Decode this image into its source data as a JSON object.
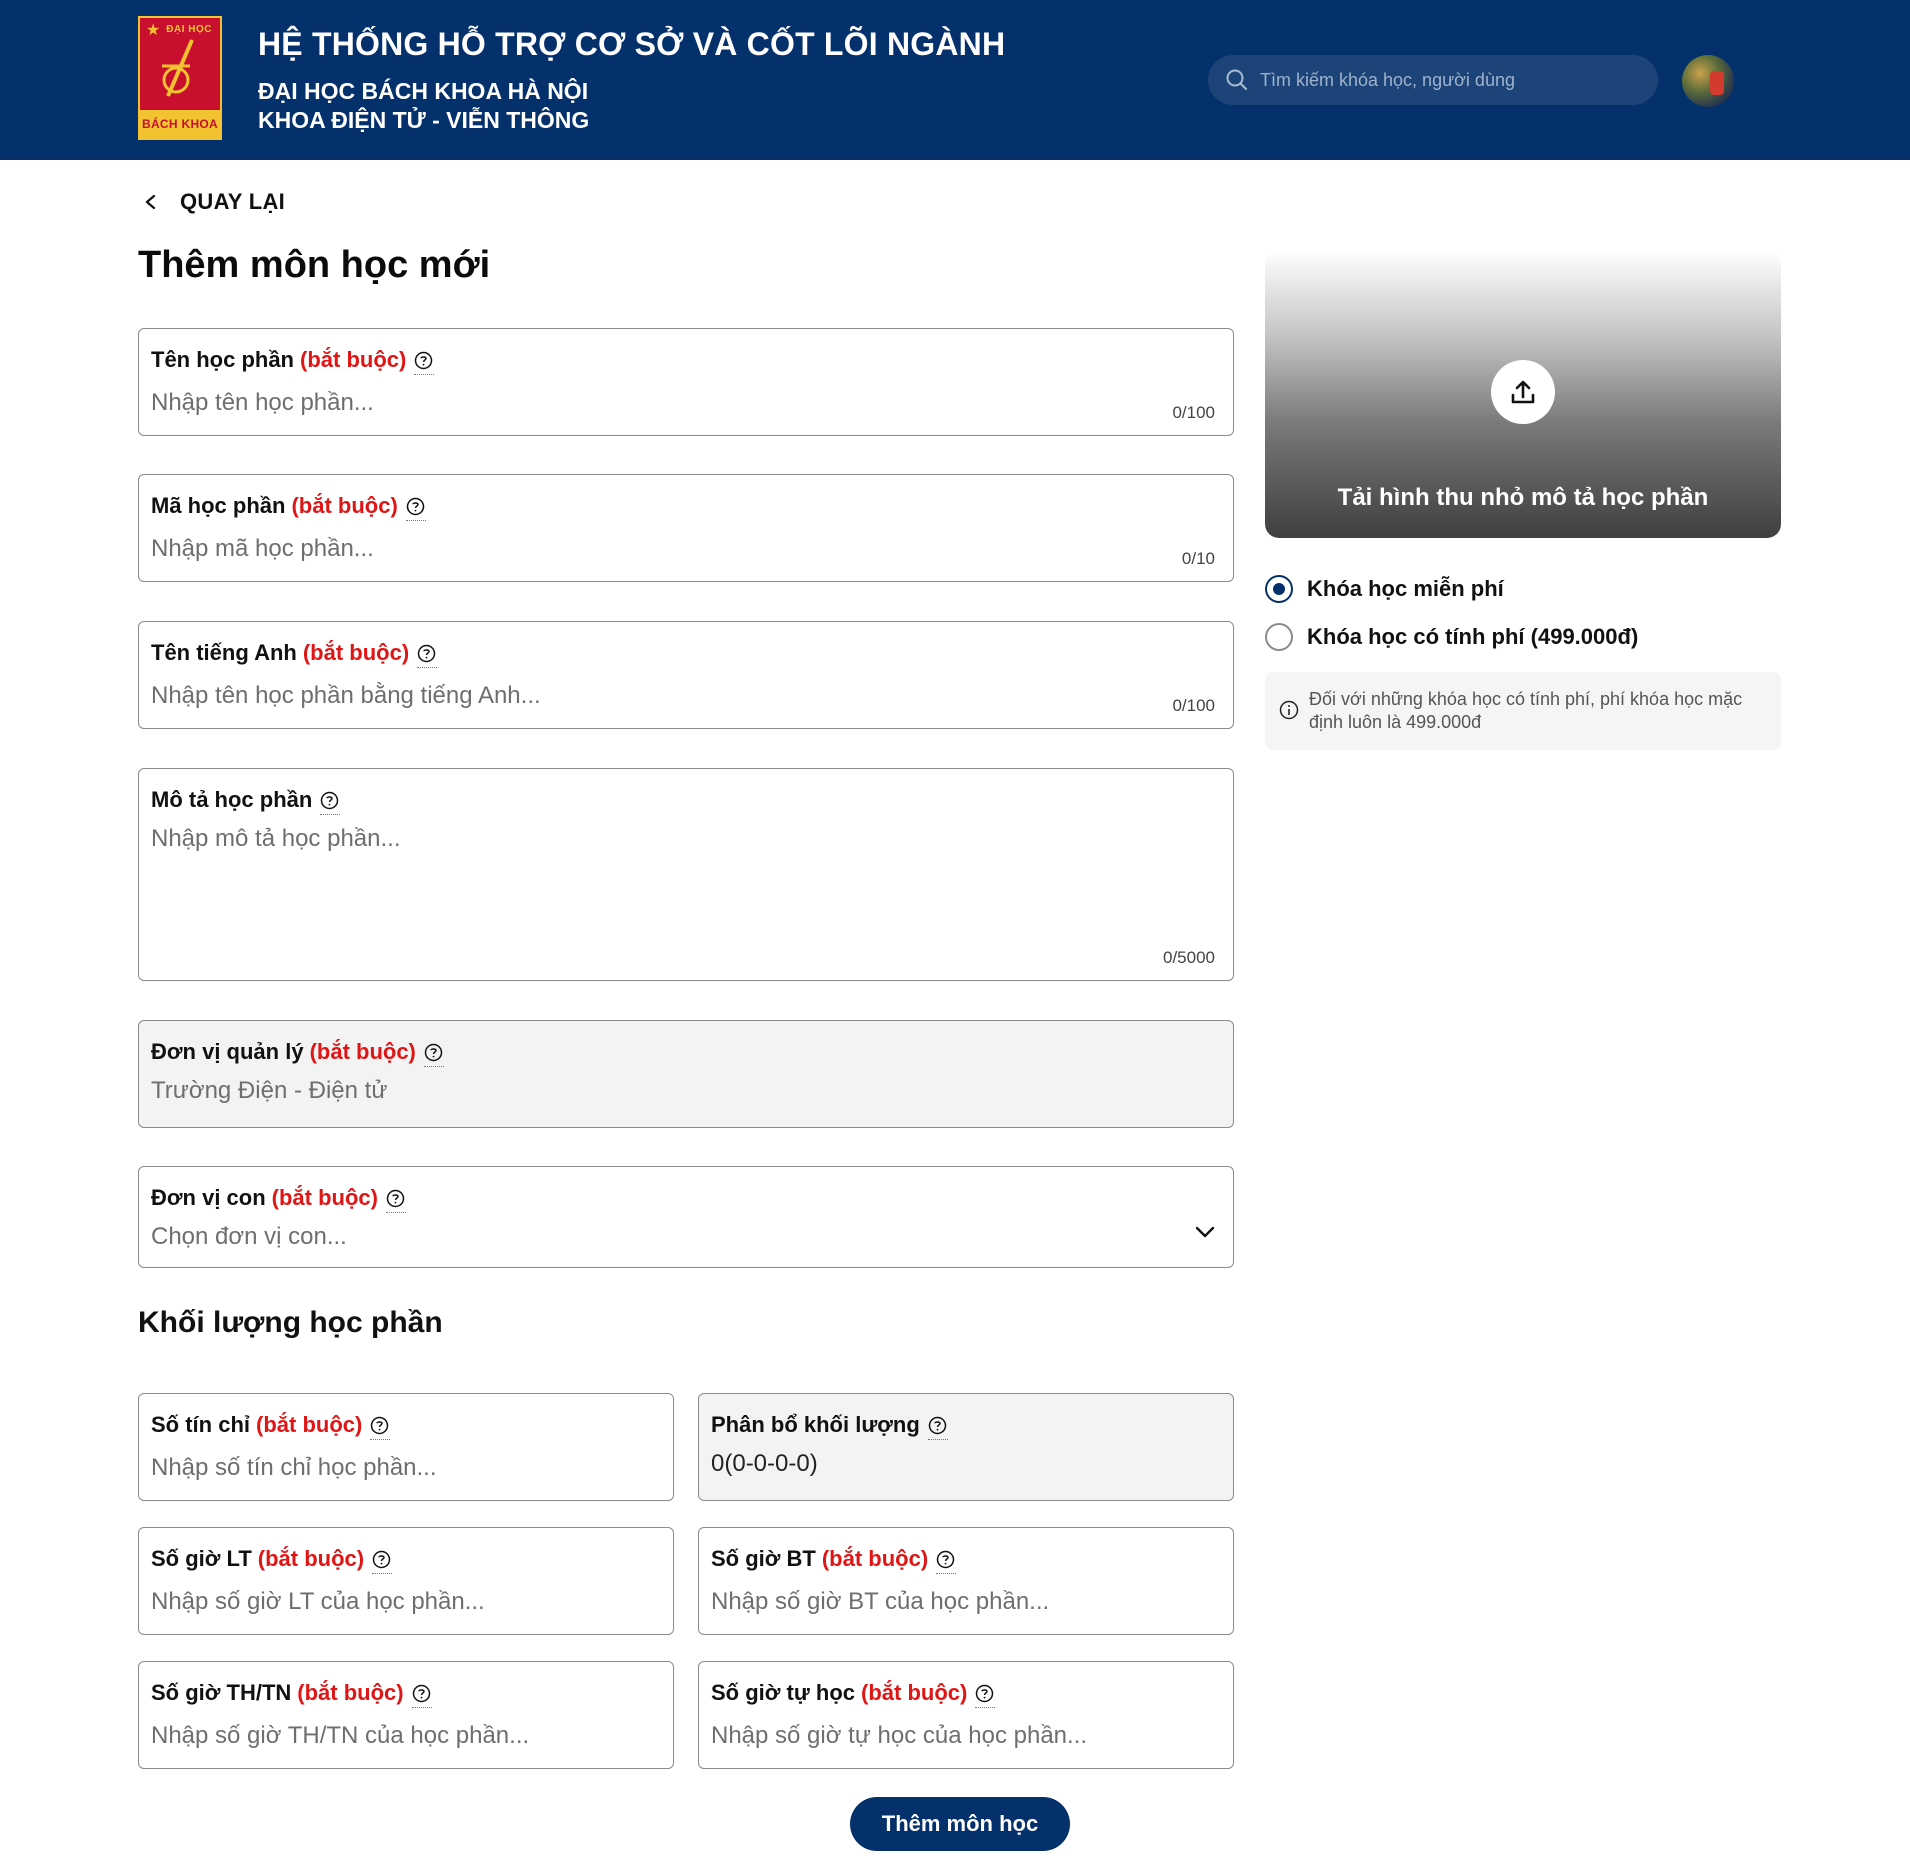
{
  "header": {
    "logo_top": "ĐẠI HỌC",
    "logo_bottom": "BÁCH KHOA",
    "title": "HỆ THỐNG HỖ TRỢ CƠ SỞ VÀ CỐT LÕI NGÀNH",
    "subtitle1": "ĐẠI HỌC BÁCH KHOA HÀ NỘI",
    "subtitle2": "KHOA ĐIỆN TỬ - VIỄN THÔNG",
    "search_placeholder": "Tìm kiếm khóa học, người dùng"
  },
  "back_label": "QUAY LẠI",
  "page_title": "Thêm môn học mới",
  "required_tag": "(bắt buộc)",
  "fields": {
    "ten_hoc_phan": {
      "label": "Tên học phần",
      "placeholder": "Nhập tên học phần...",
      "counter": "0/100"
    },
    "ma_hoc_phan": {
      "label": "Mã học phần",
      "placeholder": "Nhập mã học phần...",
      "counter": "0/10"
    },
    "ten_tieng_anh": {
      "label": "Tên tiếng Anh",
      "placeholder": "Nhập tên học phần bằng tiếng Anh...",
      "counter": "0/100"
    },
    "mo_ta": {
      "label": "Mô tả học phần",
      "placeholder": "Nhập mô tả học phần...",
      "counter": "0/5000"
    },
    "don_vi_quan_ly": {
      "label": "Đơn vị quản lý",
      "value": "Trường Điện - Điện tử"
    },
    "don_vi_con": {
      "label": "Đơn vị con",
      "placeholder": "Chọn đơn vị con..."
    }
  },
  "section_title": "Khối lượng học phần",
  "workload": {
    "so_tin_chi": {
      "label": "Số tín chỉ",
      "placeholder": "Nhập số tín chỉ học phần..."
    },
    "phan_bo": {
      "label": "Phân bổ khối lượng",
      "value": "0(0-0-0-0)"
    },
    "so_gio_lt": {
      "label": "Số giờ LT",
      "placeholder": "Nhập số giờ LT của học phần..."
    },
    "so_gio_bt": {
      "label": "Số giờ BT",
      "placeholder": "Nhập số giờ BT của học phần..."
    },
    "so_gio_th": {
      "label": "Số giờ TH/TN",
      "placeholder": "Nhập số giờ TH/TN của học phần..."
    },
    "so_gio_tu_hoc": {
      "label": "Số giờ tự học",
      "placeholder": "Nhập số giờ tự học của học phần..."
    }
  },
  "upload_label": "Tải hình thu nhỏ mô tả học phần",
  "pricing": {
    "free_label": "Khóa học miễn phí",
    "paid_label": "Khóa học có tính phí (499.000đ)",
    "selected": "free",
    "note": "Đối với những khóa học có tính phí, phí khóa học mặc định luôn là 499.000đ"
  },
  "submit_label": "Thêm môn học",
  "colors": {
    "primary": "#04316b",
    "required": "#e01515"
  },
  "icons": [
    "search-icon",
    "back-chevron-icon",
    "help-icon",
    "chevron-down-icon",
    "upload-icon",
    "info-icon"
  ]
}
